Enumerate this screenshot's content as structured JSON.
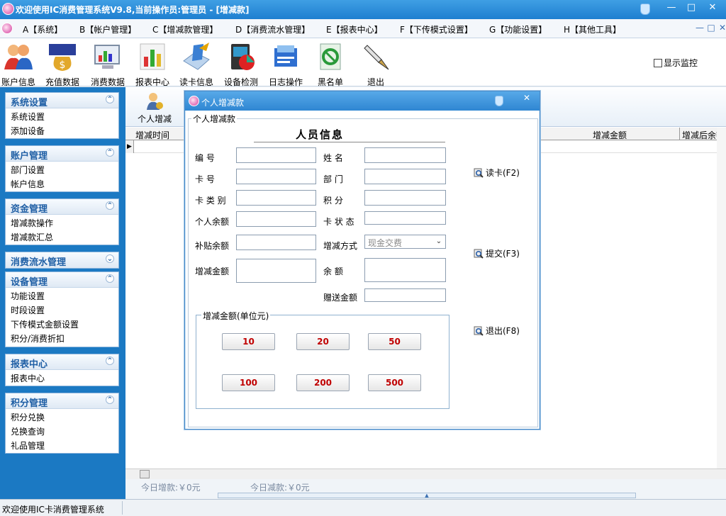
{
  "titlebar": {
    "title": "欢迎使用IC消费管理系统V9.8,当前操作员:管理员 - [增减款]",
    "min": "—",
    "max": "□",
    "close": "✕"
  },
  "menu": {
    "items": [
      "A【系统】",
      "B【帐户管理】",
      "C【增减款管理】",
      "D【消费流水管理】",
      "E【报表中心】",
      "F【下传模式设置】",
      "G【功能设置】",
      "H【其他工具】"
    ],
    "mdi_min": "—",
    "mdi_restore": "□",
    "mdi_close": "✕"
  },
  "toolbar": {
    "items": [
      {
        "label": "账户信息",
        "icon": "users-icon"
      },
      {
        "label": "充值数据",
        "icon": "money-bag-icon"
      },
      {
        "label": "消费数据",
        "icon": "chart-monitor-icon"
      },
      {
        "label": "报表中心",
        "icon": "bar-chart-icon"
      },
      {
        "label": "读卡信息",
        "icon": "card-reader-icon"
      },
      {
        "label": "设备检测",
        "icon": "device-check-icon"
      },
      {
        "label": "日志操作",
        "icon": "log-icon"
      },
      {
        "label": "黑名单",
        "icon": "blacklist-icon"
      },
      {
        "label": "退出",
        "icon": "exit-pen-icon"
      }
    ],
    "monitor_label": "显示监控"
  },
  "sidebar": {
    "groups": [
      {
        "title": "系统设置",
        "items": [
          "系统设置",
          "添加设备"
        ],
        "chev": "⌃"
      },
      {
        "title": "账户管理",
        "items": [
          "部门设置",
          "帐户信息"
        ],
        "chev": "⌃"
      },
      {
        "title": "资金管理",
        "items": [
          "增减款操作",
          "增减款汇总"
        ],
        "chev": "⌃"
      },
      {
        "title": "消费流水管理",
        "items": [],
        "chev": "⌄"
      },
      {
        "title": "设备管理",
        "items": [
          "功能设置",
          "时段设置",
          "下传模式金额设置",
          "积分/消费折扣"
        ],
        "chev": "⌃"
      },
      {
        "title": "报表中心",
        "items": [
          "报表中心"
        ],
        "chev": "⌃"
      },
      {
        "title": "积分管理",
        "items": [
          "积分兑换",
          "兑换查询",
          "礼品管理"
        ],
        "chev": "⌃"
      }
    ]
  },
  "main": {
    "subtool_label": "个人增减",
    "columns": [
      "增减时间",
      "增减金额",
      "增减后余额"
    ],
    "row_indicator": "▶",
    "summary_add": "今日增款:￥0元",
    "summary_sub": "今日减款:￥0元",
    "splitter_glyph": "▲"
  },
  "statusbar": {
    "text": "欢迎使用IC卡消费管理系统"
  },
  "dialog": {
    "title": "个人增减款",
    "close": "✕",
    "frame_legend": "个人增减款",
    "info_title": "人员信息",
    "left_fields": [
      {
        "label": "编    号",
        "value": ""
      },
      {
        "label": "卡    号",
        "value": ""
      },
      {
        "label": "卡 类 别",
        "value": ""
      },
      {
        "label": "个人余额",
        "value": ""
      },
      {
        "label": "补贴余额",
        "value": ""
      },
      {
        "label": "增减金额",
        "value": ""
      }
    ],
    "right_fields": [
      {
        "label": "姓    名",
        "value": ""
      },
      {
        "label": "部    门",
        "value": ""
      },
      {
        "label": "积    分",
        "value": ""
      },
      {
        "label": "卡 状 态",
        "value": ""
      },
      {
        "label": "增减方式",
        "value": "现金交费"
      },
      {
        "label": "余    额",
        "value": ""
      },
      {
        "label": "赠送金额",
        "value": ""
      }
    ],
    "select_arrow": "⌄",
    "buttons": [
      "读卡(F2)",
      "提交(F3)",
      "退出(F8)"
    ],
    "amount_legend": "增减金额(单位元)",
    "amounts": [
      "10",
      "20",
      "50",
      "100",
      "200",
      "500"
    ]
  },
  "colors": {
    "titlebar": "#2f8ad8",
    "sidebar": "#1b79c3",
    "group_title": "#1f5fa5",
    "amount_text": "#c00000"
  }
}
